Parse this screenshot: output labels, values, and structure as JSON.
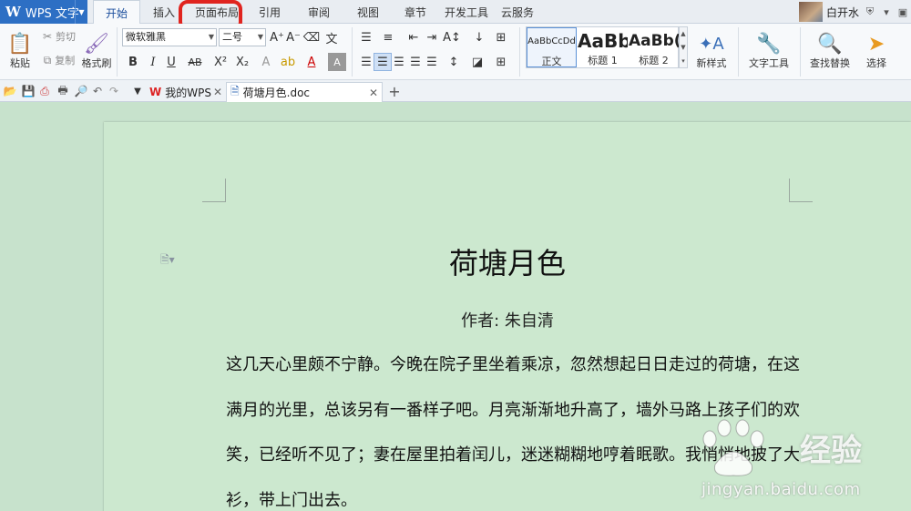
{
  "app": {
    "menu_label": "WPS 文字",
    "logo_glyph": "W"
  },
  "menu_tabs": [
    {
      "label": "开始",
      "active": true
    },
    {
      "label": "插入"
    },
    {
      "label": "页面布局",
      "highlighted": true
    },
    {
      "label": "引用"
    },
    {
      "label": "审阅"
    },
    {
      "label": "视图"
    },
    {
      "label": "章节"
    },
    {
      "label": "开发工具"
    },
    {
      "label": "云服务"
    }
  ],
  "user": {
    "name": "白开水"
  },
  "ribbon": {
    "paste": "粘贴",
    "cut": "剪切",
    "copy": "复制",
    "format_painter": "格式刷",
    "font_name": "微软雅黑",
    "font_size": "二号",
    "styles": [
      {
        "sample": "AaBbCcDd",
        "name": "正文"
      },
      {
        "sample": "AaBb",
        "name": "标题 1"
      },
      {
        "sample": "AaBb(",
        "name": "标题 2"
      }
    ],
    "new_style": "新样式",
    "text_tools": "文字工具",
    "find_replace": "查找替换",
    "select": "选择"
  },
  "tabs": [
    {
      "label": "我的WPS"
    },
    {
      "label": "荷塘月色.doc",
      "active": true
    }
  ],
  "document": {
    "title": "荷塘月色",
    "author": "作者: 朱自清",
    "lines": [
      "这几天心里颇不宁静。今晚在院子里坐着乘凉，忽然想起日日走过的荷塘，在这",
      "满月的光里，总该另有一番样子吧。月亮渐渐地升高了，墙外马路上孩子们的欢",
      "笑，已经听不见了；妻在屋里拍着闰儿，迷迷糊糊地哼着眠歌。我悄悄地披了大",
      "衫，带上门出去。"
    ]
  },
  "watermark": {
    "brand": "经验",
    "url": "jingyan.baidu.com"
  },
  "colors": {
    "accent": "#2d6fc4",
    "highlight_ring": "#e0241f",
    "page_bg": "#cce8cf"
  }
}
